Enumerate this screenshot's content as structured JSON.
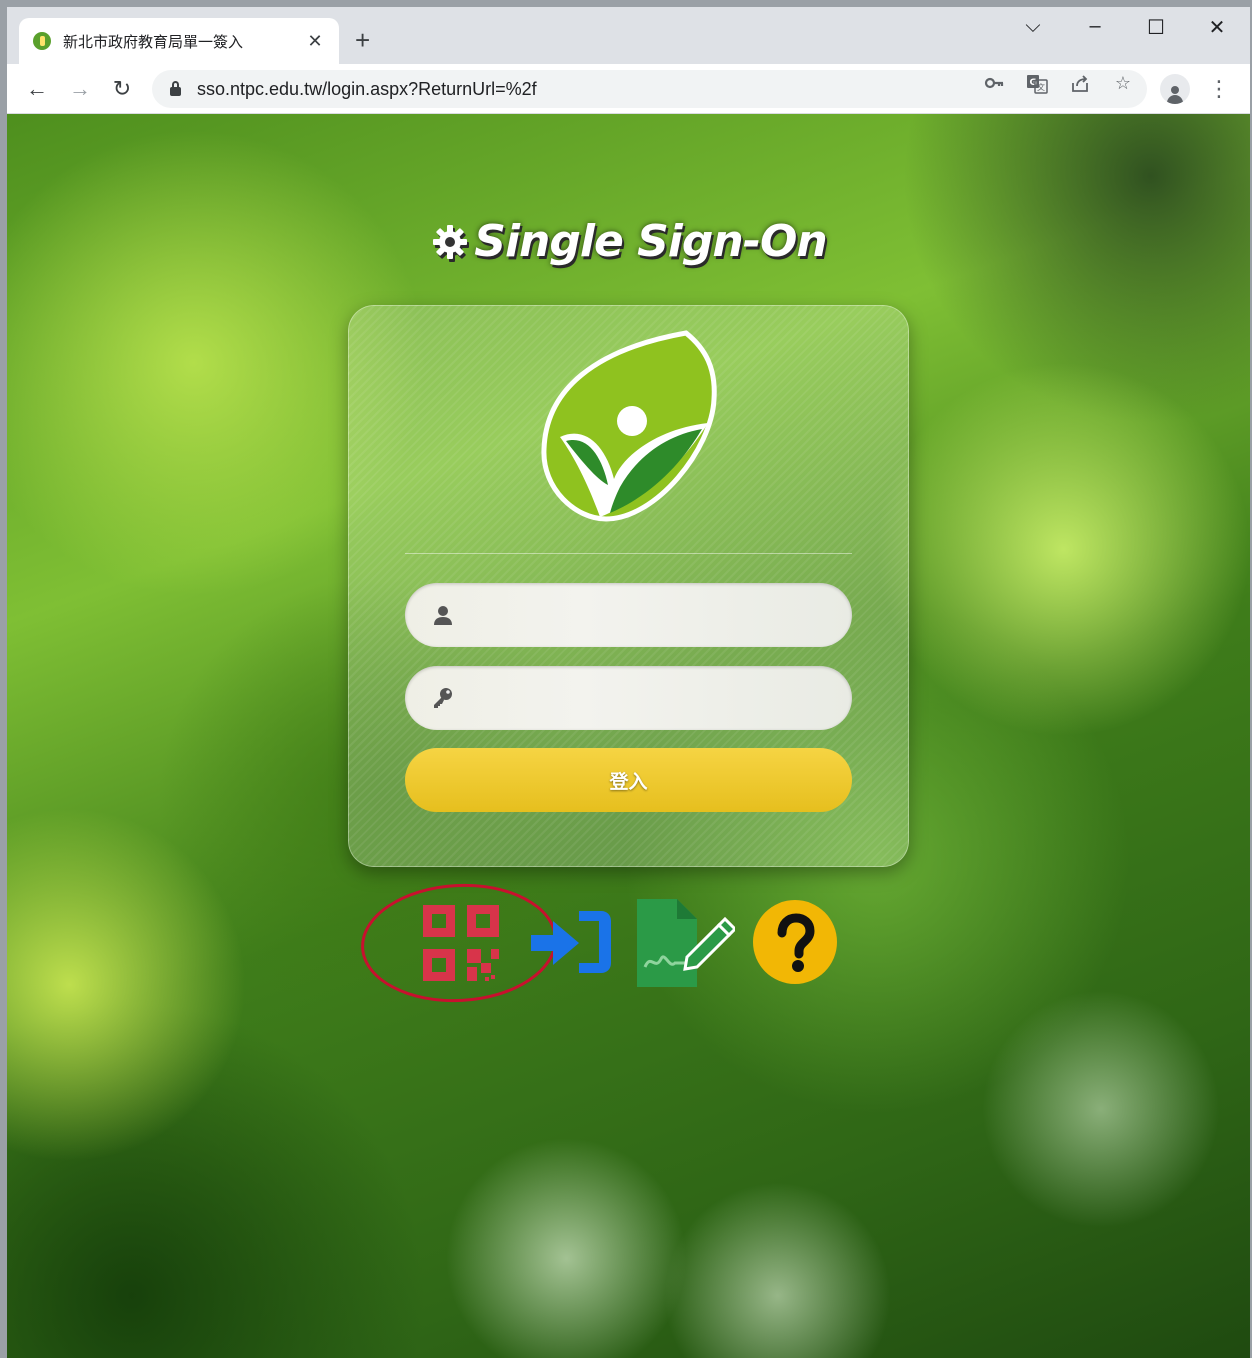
{
  "browser": {
    "tab_title": "新北市政府教育局單一簽入",
    "url": "sso.ntpc.edu.tw/login.aspx?ReturnUrl=%2f",
    "icons": {
      "back": "arrow-left-icon",
      "forward": "arrow-right-icon",
      "reload": "reload-icon",
      "tab_close": "close-icon",
      "new_tab": "plus-icon",
      "key": "key-icon",
      "translate": "translate-icon",
      "share": "share-icon",
      "bookmark": "star-icon",
      "profile": "profile-icon",
      "menu": "more-vert-icon"
    }
  },
  "page": {
    "title": "Single Sign-On",
    "username": {
      "placeholder": "",
      "icon": "user-icon"
    },
    "password": {
      "placeholder": "",
      "icon": "key-icon"
    },
    "login_button": "登入",
    "quick_links": [
      {
        "name": "qrcode-login",
        "icon": "qrcode-icon",
        "color": "#d8344a"
      },
      {
        "name": "login",
        "icon": "sign-in-icon",
        "color": "#1a73e8"
      },
      {
        "name": "register",
        "icon": "signature-edit-icon",
        "color": "#2b9a47"
      },
      {
        "name": "help",
        "icon": "question-circle-icon",
        "color": "#f2b705"
      }
    ],
    "colors": {
      "login_button": "#f2cd33",
      "highlight_ring": "#c8102e"
    }
  }
}
